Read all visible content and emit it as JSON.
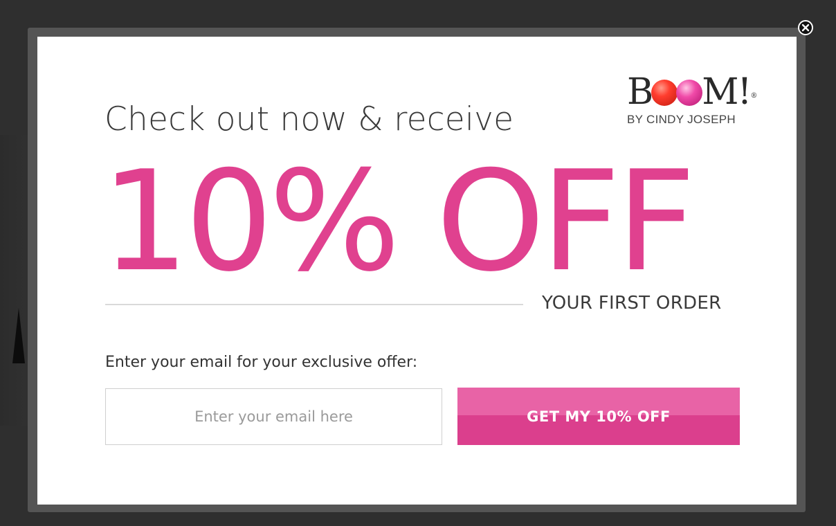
{
  "modal": {
    "headline": "Check out now & receive",
    "offer": "10% OFF",
    "subhead": "YOUR FIRST ORDER",
    "email_prompt": "Enter your email for your exclusive offer:",
    "email_input": {
      "value": "",
      "placeholder": "Enter your email here"
    },
    "cta_label": "GET MY 10% OFF",
    "close_icon": "close-circle-icon"
  },
  "logo": {
    "wordmark_letters": [
      "B",
      "M!"
    ],
    "tagline": "BY CINDY JOSEPH"
  },
  "colors": {
    "accent": "#e0418f",
    "cta_top": "#e863a6",
    "cta_bottom": "#db3f8d",
    "overlay": "#2f2f2f"
  }
}
